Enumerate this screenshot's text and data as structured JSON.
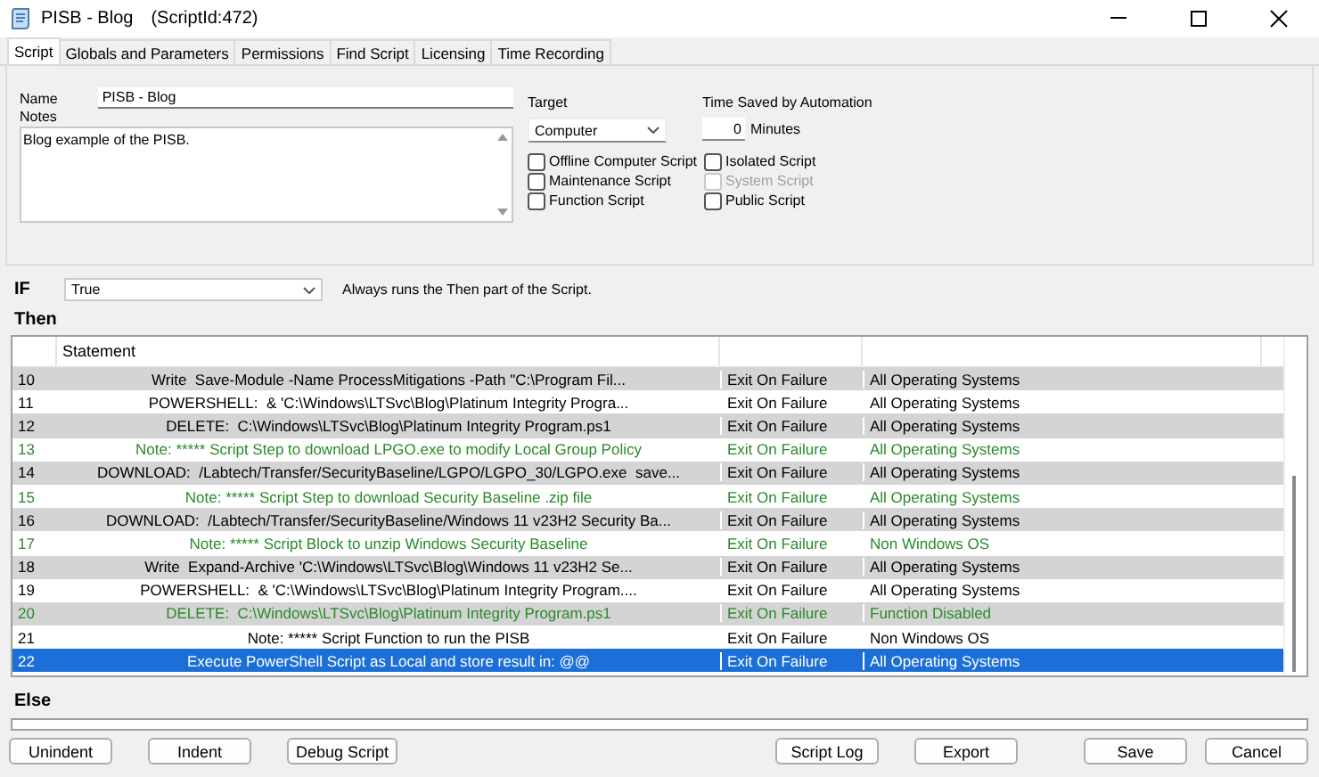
{
  "window": {
    "title": "PISB - Blog",
    "script_id": "(ScriptId:472)"
  },
  "tabs": [
    {
      "label": "Script",
      "selected": true
    },
    {
      "label": "Globals and Parameters",
      "selected": false
    },
    {
      "label": "Permissions",
      "selected": false
    },
    {
      "label": "Find Script",
      "selected": false
    },
    {
      "label": "Licensing",
      "selected": false
    },
    {
      "label": "Time Recording",
      "selected": false
    }
  ],
  "name": {
    "label": "Name",
    "value": "PISB - Blog"
  },
  "notes": {
    "label": "Notes",
    "value": "Blog example of the PISB."
  },
  "target": {
    "label": "Target",
    "value": "Computer"
  },
  "time_saved": {
    "label": "Time Saved by Automation",
    "value": "0",
    "unit": "Minutes"
  },
  "options": [
    {
      "label": "Offline Computer Script",
      "checked": false,
      "disabled": false
    },
    {
      "label": "Maintenance Script",
      "checked": false,
      "disabled": false
    },
    {
      "label": "Function Script",
      "checked": false,
      "disabled": false
    },
    {
      "label": "Isolated Script",
      "checked": false,
      "disabled": false
    },
    {
      "label": "System Script",
      "checked": false,
      "disabled": true
    },
    {
      "label": "Public Script",
      "checked": false,
      "disabled": false
    }
  ],
  "if": {
    "label": "IF",
    "value": "True",
    "hint": "Always runs the Then part of the Script."
  },
  "then": {
    "label": "Then",
    "statement_header": "Statement",
    "rows": [
      {
        "number": "10",
        "statement": "Write  Save-Module -Name ProcessMitigations -Path \"C:\\Program Fil...",
        "on_failure": "Exit On Failure",
        "os": "All Operating Systems",
        "disabled": false,
        "selected": false
      },
      {
        "number": "11",
        "statement": "POWERSHELL:  & 'C:\\Windows\\LTSvc\\Blog\\Platinum Integrity Progra...",
        "on_failure": "Exit On Failure",
        "os": "All Operating Systems",
        "disabled": false,
        "selected": false
      },
      {
        "number": "12",
        "statement": "DELETE:  C:\\Windows\\LTSvc\\Blog\\Platinum Integrity Program.ps1",
        "on_failure": "Exit On Failure",
        "os": "All Operating Systems",
        "disabled": false,
        "selected": false
      },
      {
        "number": "13",
        "statement": "Note: ***** Script Step to download LPGO.exe to modify Local Group Policy",
        "on_failure": "Exit On Failure",
        "os": "All Operating Systems",
        "disabled": true,
        "selected": false
      },
      {
        "number": "14",
        "statement": "DOWNLOAD:  /Labtech/Transfer/SecurityBaseline/LGPO/LGPO_30/LGPO.exe  save...",
        "on_failure": "Exit On Failure",
        "os": "All Operating Systems",
        "disabled": false,
        "selected": false
      },
      {
        "number": "15",
        "statement": "Note: ***** Script Step to download Security Baseline .zip file",
        "on_failure": "Exit On Failure",
        "os": "All Operating Systems",
        "disabled": true,
        "selected": false
      },
      {
        "number": "16",
        "statement": "DOWNLOAD:  /Labtech/Transfer/SecurityBaseline/Windows 11 v23H2 Security Ba...",
        "on_failure": "Exit On Failure",
        "os": "All Operating Systems",
        "disabled": false,
        "selected": false
      },
      {
        "number": "17",
        "statement": "Note: ***** Script Block to unzip Windows Security Baseline",
        "on_failure": "Exit On Failure",
        "os": "Non Windows OS",
        "disabled": true,
        "selected": false
      },
      {
        "number": "18",
        "statement": "Write  Expand-Archive 'C:\\Windows\\LTSvc\\Blog\\Windows 11 v23H2 Se...",
        "on_failure": "Exit On Failure",
        "os": "All Operating Systems",
        "disabled": false,
        "selected": false
      },
      {
        "number": "19",
        "statement": "POWERSHELL:  & 'C:\\Windows\\LTSvc\\Blog\\Platinum Integrity Program....",
        "on_failure": "Exit On Failure",
        "os": "All Operating Systems",
        "disabled": false,
        "selected": false
      },
      {
        "number": "20",
        "statement": "DELETE:  C:\\Windows\\LTSvc\\Blog\\Platinum Integrity Program.ps1",
        "on_failure": "Exit On Failure",
        "os": "Function Disabled",
        "disabled": true,
        "selected": false
      },
      {
        "number": "21",
        "statement": "Note: ***** Script Function to run the PISB",
        "on_failure": "Exit On Failure",
        "os": "Non Windows OS",
        "disabled": false,
        "selected": false
      },
      {
        "number": "22",
        "statement": "Execute PowerShell Script as Local and store result in: @@",
        "on_failure": "Exit On Failure",
        "os": "All Operating Systems",
        "disabled": false,
        "selected": true
      }
    ]
  },
  "else": {
    "label": "Else"
  },
  "tool_buttons": [
    "Unindent",
    "Indent",
    "Debug Script"
  ],
  "output_buttons": [
    "Script Log",
    "Export"
  ],
  "dialog_buttons": [
    "Save",
    "Cancel"
  ]
}
